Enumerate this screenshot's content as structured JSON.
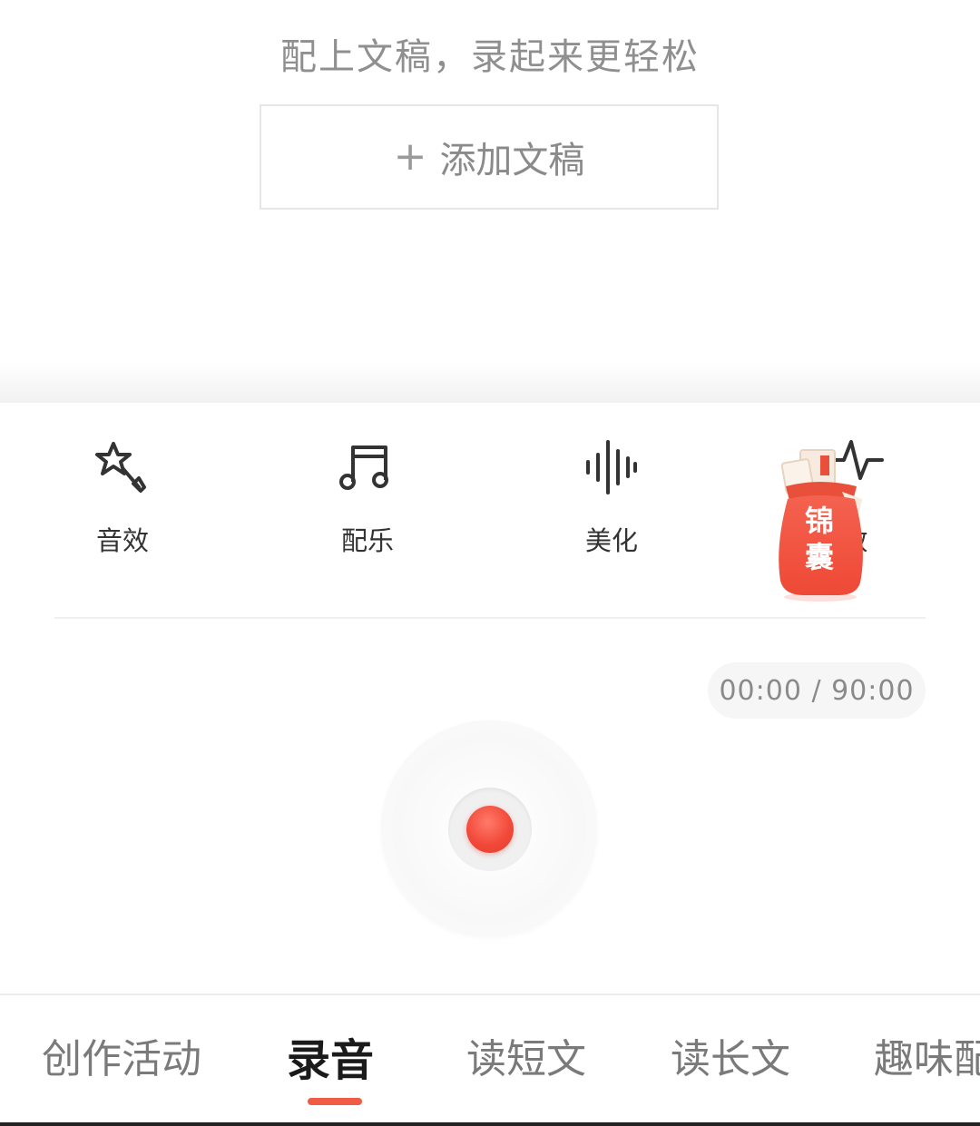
{
  "script_area": {
    "hint": "配上文稿，录起来更轻松",
    "add_button_plus": "+",
    "add_button_label": "添加文稿"
  },
  "tools": [
    {
      "label": "音效",
      "icon": "magic-wand-icon"
    },
    {
      "label": "配乐",
      "icon": "music-note-icon"
    },
    {
      "label": "美化",
      "icon": "sound-wave-icon"
    },
    {
      "label": "效",
      "icon": "pulse-icon"
    }
  ],
  "lucky_bag": {
    "text": "锦\n囊",
    "color": "#f0523f"
  },
  "timer": {
    "text": "00:00 / 90:00"
  },
  "record": {
    "accent_color": "#f24a3a"
  },
  "tabs": [
    {
      "label": "创作活动",
      "active": false
    },
    {
      "label": "录音",
      "active": true
    },
    {
      "label": "读短文",
      "active": false
    },
    {
      "label": "读长文",
      "active": false
    },
    {
      "label": "趣味配",
      "active": false
    }
  ],
  "colors": {
    "accent": "#ef5b44",
    "text_muted": "#8a8a8a",
    "text_dark": "#1a1a1a"
  }
}
